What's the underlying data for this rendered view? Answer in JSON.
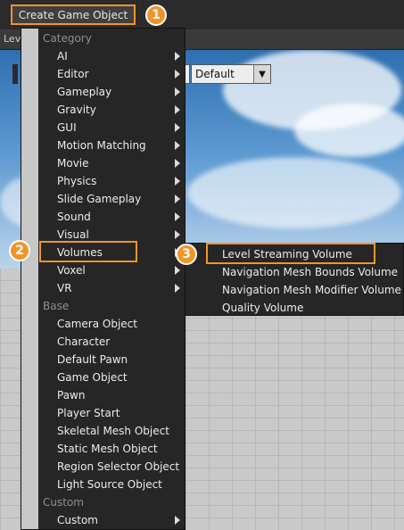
{
  "toolbar": {
    "create_label": "Create Game Object",
    "level_label": "Lev",
    "combo_value": "Default"
  },
  "menu": {
    "header_category": "Category",
    "header_base": "Base",
    "header_custom": "Custom",
    "category_items": [
      "AI",
      "Editor",
      "Gameplay",
      "Gravity",
      "GUI",
      "Motion Matching",
      "Movie",
      "Physics",
      "Slide Gameplay",
      "Sound",
      "Visual",
      "Volumes",
      "Voxel",
      "VR"
    ],
    "base_items": [
      "Camera Object",
      "Character",
      "Default Pawn",
      "Game Object",
      "Pawn",
      "Player Start",
      "Skeletal Mesh Object",
      "Static Mesh Object",
      "Region Selector Object",
      "Light Source Object"
    ],
    "custom_items": [
      "Custom"
    ]
  },
  "submenu": {
    "items": [
      "Level Streaming Volume",
      "Navigation Mesh Bounds Volume",
      "Navigation Mesh Modifier Volume",
      "Quality Volume"
    ]
  },
  "badges": [
    "1",
    "2",
    "3"
  ],
  "colors": {
    "accent": "#f0952b",
    "menu_bg": "#262626"
  }
}
